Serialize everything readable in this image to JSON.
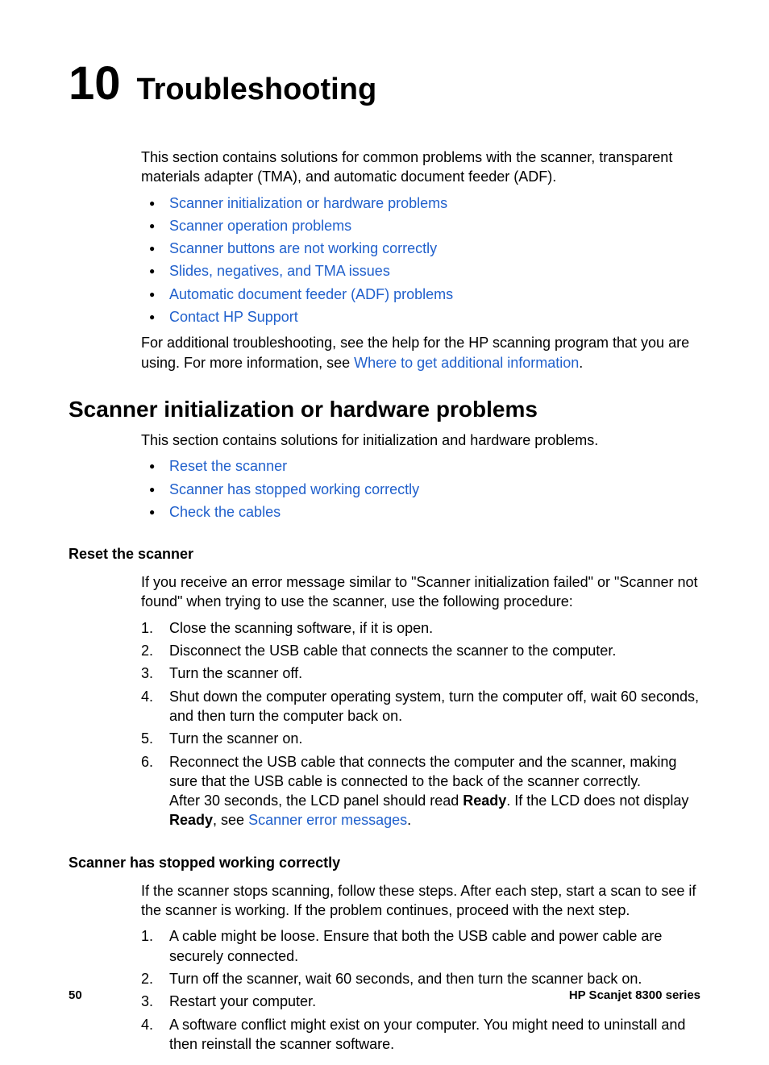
{
  "chapter_number": "10",
  "chapter_title": "Troubleshooting",
  "intro_text": "This section contains solutions for common problems with the scanner, transparent materials adapter (TMA), and automatic document feeder (ADF).",
  "top_links": [
    "Scanner initialization or hardware problems",
    "Scanner operation problems",
    "Scanner buttons are not working correctly",
    "Slides, negatives, and TMA issues",
    "Automatic document feeder (ADF) problems",
    "Contact HP Support"
  ],
  "post_list_text_1": "For additional troubleshooting, see the help for the HP scanning program that you are using. For more information, see ",
  "post_list_link": "Where to get additional information",
  "post_list_text_2": ".",
  "section1_title": "Scanner initialization or hardware problems",
  "section1_intro": "This section contains solutions for initialization and hardware problems.",
  "section1_links": [
    "Reset the scanner",
    "Scanner has stopped working correctly",
    "Check the cables"
  ],
  "sub1_title": "Reset the scanner",
  "sub1_intro": "If you receive an error message similar to \"Scanner initialization failed\" or \"Scanner not found\" when trying to use the scanner, use the following procedure:",
  "sub1_steps": {
    "s1": "Close the scanning software, if it is open.",
    "s2": "Disconnect the USB cable that connects the scanner to the computer.",
    "s3": "Turn the scanner off.",
    "s4": "Shut down the computer operating system, turn the computer off, wait 60 seconds, and then turn the computer back on.",
    "s5": "Turn the scanner on.",
    "s6_a": "Reconnect the USB cable that connects the computer and the scanner, making sure that the USB cable is connected to the back of the scanner correctly.",
    "s6_b1": "After 30 seconds, the LCD panel should read ",
    "s6_ready1": "Ready",
    "s6_b2": ". If the LCD does not display ",
    "s6_ready2": "Ready",
    "s6_b3": ", see ",
    "s6_link": "Scanner error messages",
    "s6_b4": "."
  },
  "sub2_title": "Scanner has stopped working correctly",
  "sub2_intro": "If the scanner stops scanning, follow these steps. After each step, start a scan to see if the scanner is working. If the problem continues, proceed with the next step.",
  "sub2_steps": {
    "s1": "A cable might be loose. Ensure that both the USB cable and power cable are securely connected.",
    "s2": "Turn off the scanner, wait 60 seconds, and then turn the scanner back on.",
    "s3": "Restart your computer.",
    "s4": "A software conflict might exist on your computer. You might need to uninstall and then reinstall the scanner software."
  },
  "footer_page": "50",
  "footer_product": "HP Scanjet 8300 series"
}
